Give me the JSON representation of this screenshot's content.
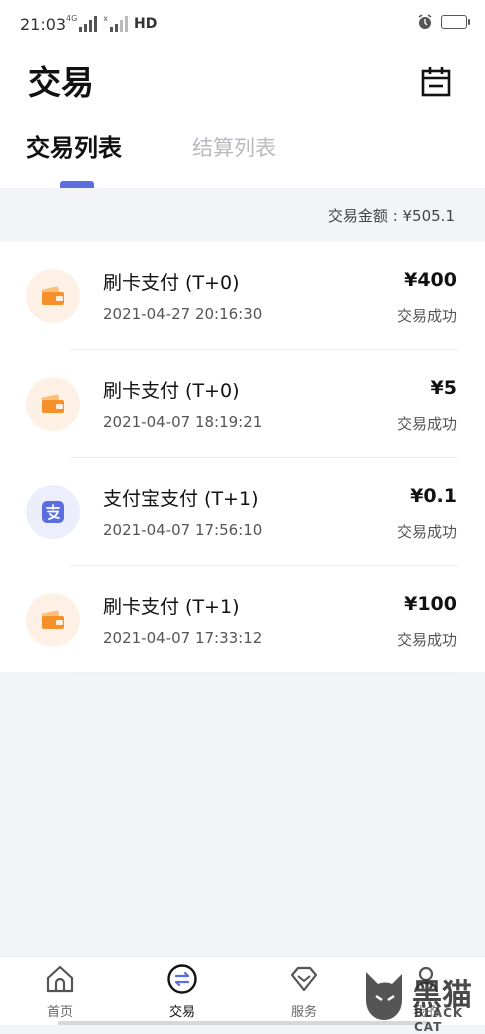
{
  "status": {
    "time": "21:03",
    "net1": "4G",
    "net2": "x",
    "hd": "HD"
  },
  "header": {
    "title": "交易"
  },
  "tabs": [
    {
      "label": "交易列表"
    },
    {
      "label": "结算列表"
    }
  ],
  "summary": {
    "amount_text": "交易金额 : ¥505.1"
  },
  "transactions": [
    {
      "name": "刷卡支付 (T+0)",
      "date": "2021-04-27 20:16:30",
      "amount": "¥400",
      "status": "交易成功",
      "icon": "wallet-icon"
    },
    {
      "name": "刷卡支付 (T+0)",
      "date": "2021-04-07 18:19:21",
      "amount": "¥5",
      "status": "交易成功",
      "icon": "wallet-icon"
    },
    {
      "name": "支付宝支付 (T+1)",
      "date": "2021-04-07 17:56:10",
      "amount": "¥0.1",
      "status": "交易成功",
      "icon": "alipay-icon"
    },
    {
      "name": "刷卡支付 (T+1)",
      "date": "2021-04-07 17:33:12",
      "amount": "¥100",
      "status": "交易成功",
      "icon": "wallet-icon"
    }
  ],
  "nav": [
    {
      "label": "首页",
      "icon": "home-icon"
    },
    {
      "label": "交易",
      "icon": "exchange-icon"
    },
    {
      "label": "服务",
      "icon": "diamond-icon"
    },
    {
      "label": "我的",
      "icon": "user-icon"
    }
  ],
  "watermark": {
    "text1": "黑猫",
    "text2": "BLACK CAT"
  },
  "colors": {
    "accent": "#5b6ee0",
    "card_icon": "#f5902b",
    "card_bg": "#fdf1e6",
    "alipay_icon": "#5b6ee0",
    "alipay_bg": "#eceefb",
    "page_bg": "#f3f4f7"
  }
}
